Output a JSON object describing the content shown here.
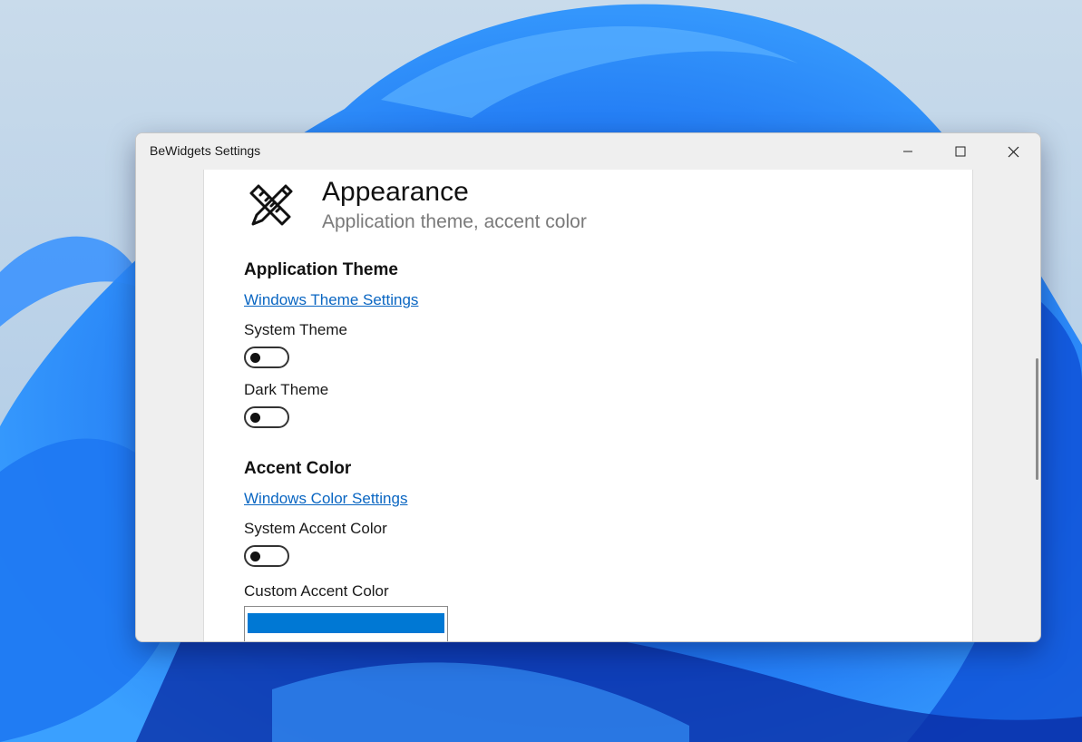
{
  "window": {
    "title": "BeWidgets Settings",
    "controls": {
      "minimize": "minimize-icon",
      "maximize": "maximize-icon",
      "close": "close-icon"
    }
  },
  "header": {
    "icon": "pencil-ruler-icon",
    "title": "Appearance",
    "subtitle": "Application theme, accent color"
  },
  "sections": {
    "theme": {
      "heading": "Application Theme",
      "link": "Windows Theme Settings",
      "system_theme_label": "System Theme",
      "system_theme_on": false,
      "dark_theme_label": "Dark Theme",
      "dark_theme_on": false
    },
    "accent": {
      "heading": "Accent Color",
      "link": "Windows Color Settings",
      "system_accent_label": "System Accent Color",
      "system_accent_on": false,
      "custom_accent_label": "Custom Accent Color",
      "custom_accent_color": "#0078d4"
    }
  },
  "colors": {
    "link": "#0a66c2",
    "accent": "#0078d4"
  }
}
